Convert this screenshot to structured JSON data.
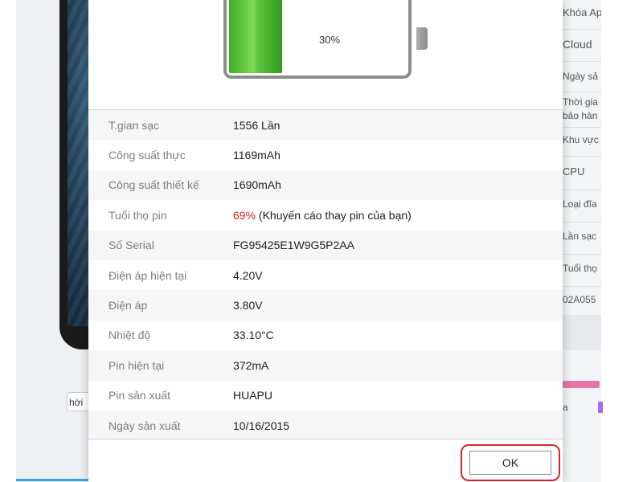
{
  "background": {
    "left_button_label": "hời",
    "right_panel_items": [
      "Khóa Ap",
      "Cloud",
      "Ngày sả",
      "Thời gia",
      "bảo hàn",
      "Khu vực",
      "CPU",
      "Loại đĩa",
      "Lần sạc",
      "Tuổi thọ",
      "02A055"
    ],
    "legend_a": "a"
  },
  "dialog": {
    "battery_percent": "30%",
    "battery_level": 0.3,
    "rows": [
      {
        "label": "T.gian sạc",
        "value": "1556 Lần"
      },
      {
        "label": "Công suất thực",
        "value": "1169mAh"
      },
      {
        "label": "Công suất thiết kế",
        "value": "1690mAh"
      },
      {
        "label": "Tuổi thọ pin",
        "value_warn": "69%",
        "value": " (Khuyến cáo thay pin của bạn)"
      },
      {
        "label": "Số Serial",
        "value": "FG95425E1W9G5P2AA"
      },
      {
        "label": "Điện áp hiện tại",
        "value": "4.20V"
      },
      {
        "label": "Điện áp",
        "value": "3.80V"
      },
      {
        "label": "Nhiệt độ",
        "value": "33.10°C"
      },
      {
        "label": "Pin hiện tại",
        "value": "372mA"
      },
      {
        "label": "Pin sản xuất",
        "value": "HUAPU"
      },
      {
        "label": "Ngày sản xuất",
        "value": "10/16/2015"
      }
    ],
    "ok_label": "OK"
  },
  "colors": {
    "warning": "#e02020",
    "battery_green": "#5fc43f",
    "highlight_red": "#d9262b",
    "accent_blue": "#3aa0e6"
  }
}
